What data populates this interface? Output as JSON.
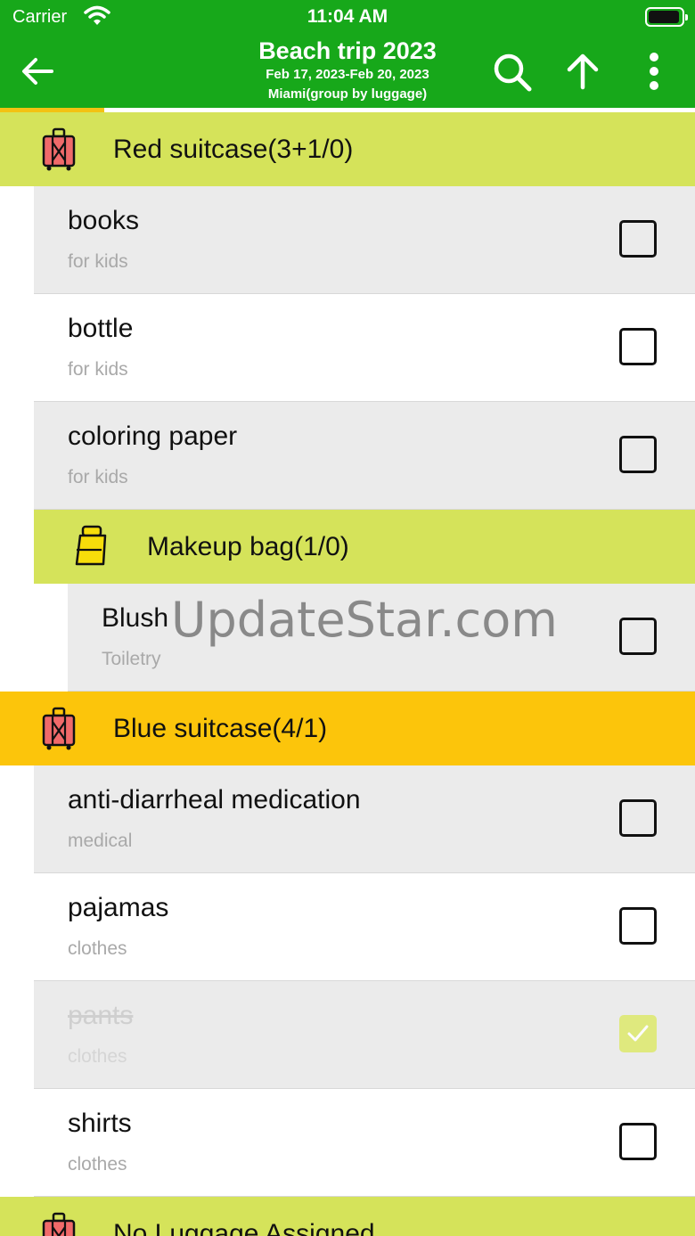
{
  "status_bar": {
    "carrier": "Carrier",
    "time": "11:04 AM"
  },
  "header": {
    "title": "Beach trip 2023",
    "dates": "Feb 17, 2023-Feb 20, 2023",
    "subtitle": "Miami(group by luggage)",
    "back_icon": "arrow-left-icon",
    "search_icon": "search-icon",
    "sort_icon": "arrow-up-icon",
    "more_icon": "more-vertical-icon",
    "bg_color": "#17a81a"
  },
  "progress": {
    "fraction": 0.15,
    "color": "#f3c212"
  },
  "groups": [
    {
      "label": "Red suitcase(3+1/0)",
      "icon": "suitcase-icon",
      "color": "#d5e35a",
      "items": [
        {
          "name": "books",
          "category": "for kids",
          "checked": false
        },
        {
          "name": "bottle",
          "category": "for kids",
          "checked": false
        },
        {
          "name": "coloring paper",
          "category": "for kids",
          "checked": false
        }
      ],
      "subgroup": {
        "label": "Makeup bag(1/0)",
        "icon": "makeup-bag-icon",
        "items": [
          {
            "name": "Blush",
            "category": "Toiletry",
            "checked": false
          }
        ]
      }
    },
    {
      "label": "Blue suitcase(4/1)",
      "icon": "suitcase-icon",
      "color": "#fcc50b",
      "items": [
        {
          "name": "anti-diarrheal medication",
          "category": "medical",
          "checked": false
        },
        {
          "name": "pajamas",
          "category": "clothes",
          "checked": false
        },
        {
          "name": "pants",
          "category": "clothes",
          "checked": true
        },
        {
          "name": "shirts",
          "category": "clothes",
          "checked": false
        }
      ]
    },
    {
      "label": "No Luggage Assigned",
      "icon": "suitcase-icon",
      "color": "#d5e35a"
    }
  ],
  "watermark": "UpdateStar.com"
}
